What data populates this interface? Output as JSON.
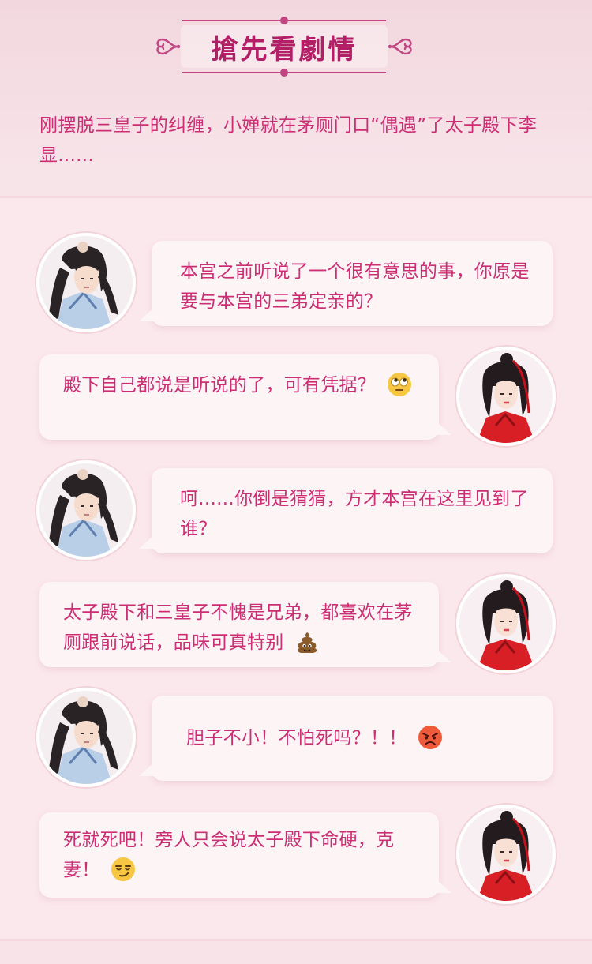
{
  "header": {
    "title": "搶先看劇情",
    "intro": "刚摆脱三皇子的纠缠，小婵就在茅厕门口“偶遇”了太子殿下李显......"
  },
  "colors": {
    "accent": "#cc2e74",
    "title": "#b21f66",
    "background": "#f7e3e8",
    "bubble": "#fdf4f6"
  },
  "messages": [
    {
      "speaker": "prince",
      "side": "left",
      "text": "本宫之前听说了一个很有意思的事，你原是要与本宫的三弟定亲的？",
      "emoji": ""
    },
    {
      "speaker": "girl",
      "side": "right",
      "text": "殿下自己都说是听说的了，可有凭据？",
      "emoji": "rolling-eyes-emoji"
    },
    {
      "speaker": "prince",
      "side": "left",
      "text": "呵......你倒是猜猜，方才本宫在这里见到了谁？",
      "emoji": ""
    },
    {
      "speaker": "girl",
      "side": "right",
      "text": "太子殿下和三皇子不愧是兄弟，都喜欢在茅厕跟前说话，品味可真特别",
      "emoji": "poop-emoji"
    },
    {
      "speaker": "prince",
      "side": "left",
      "text": "胆子不小！不怕死吗？！！",
      "emoji": "angry-face-emoji"
    },
    {
      "speaker": "girl",
      "side": "right",
      "text": "死就死吧！旁人只会说太子殿下命硬，克妻！",
      "emoji": "smirk-emoji"
    }
  ]
}
